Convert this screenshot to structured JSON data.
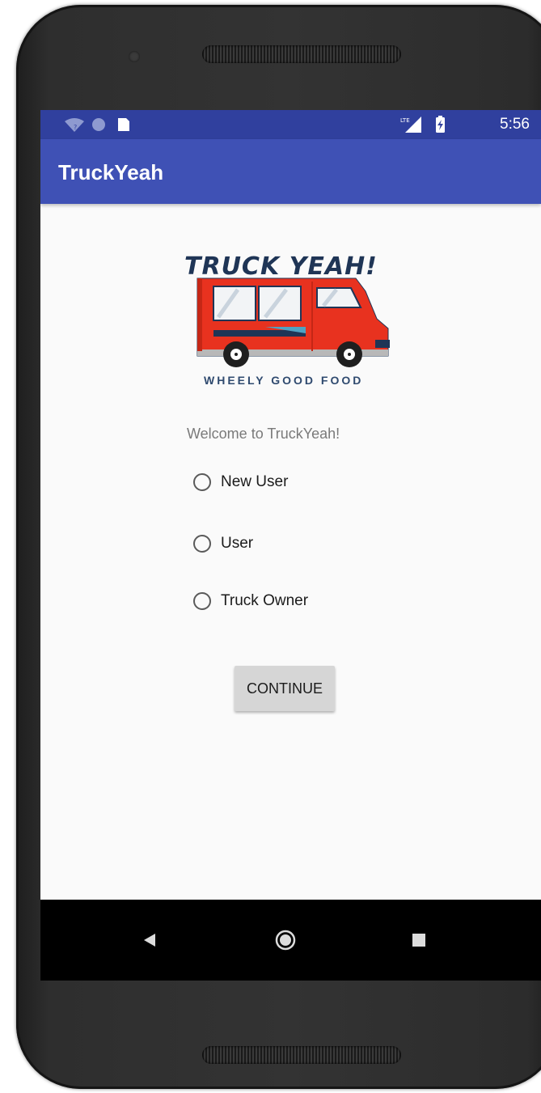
{
  "status_bar": {
    "time": "5:56",
    "left_icons": [
      "wifi-icon",
      "circle-icon",
      "sd-card-icon"
    ],
    "right_icons": [
      "lte-signal-icon",
      "battery-charging-icon"
    ],
    "network_label": "LTE"
  },
  "app_bar": {
    "title": "TruckYeah"
  },
  "logo": {
    "brand_text": "TRUCK YEAH!",
    "tagline": "WHEELY GOOD FOOD",
    "icon": "food-truck-icon"
  },
  "welcome_text": "Welcome to TruckYeah!",
  "radio_options": [
    {
      "label": "New User",
      "selected": false
    },
    {
      "label": "User",
      "selected": false
    },
    {
      "label": "Truck Owner",
      "selected": false
    }
  ],
  "continue_label": "CONTINUE",
  "nav_bar": {
    "icons": [
      "back-icon",
      "home-icon",
      "recents-icon"
    ]
  },
  "colors": {
    "primary": "#3f51b5",
    "primary_dark": "#30409e",
    "truck_red": "#e8321f",
    "logo_text": "#1f3556"
  }
}
